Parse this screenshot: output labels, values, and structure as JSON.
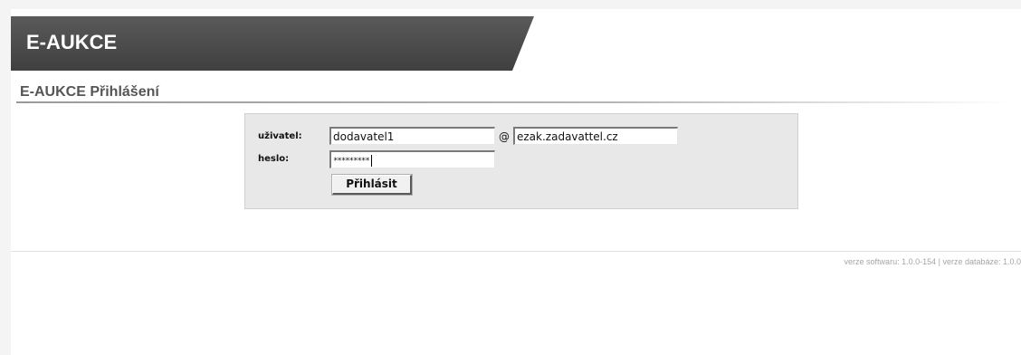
{
  "header": {
    "brand": "E-AUKCE"
  },
  "main": {
    "heading": "E-AUKCE Přihlášení"
  },
  "login_form": {
    "user_label": "uživatel:",
    "user_value": "dodavatel1",
    "at_sign": "@",
    "domain_value": "ezak.zadavattel.cz",
    "password_label": "heslo:",
    "password_masked": "*********",
    "submit_label": "Přihlásit"
  },
  "footer": {
    "version_text": "verze softwaru: 1.0.0-154 | verze databáze: 1.0.0"
  },
  "colors": {
    "header_bar": "#4d4d4d",
    "page_background": "#ffffff",
    "form_background": "#e8e8e8"
  }
}
